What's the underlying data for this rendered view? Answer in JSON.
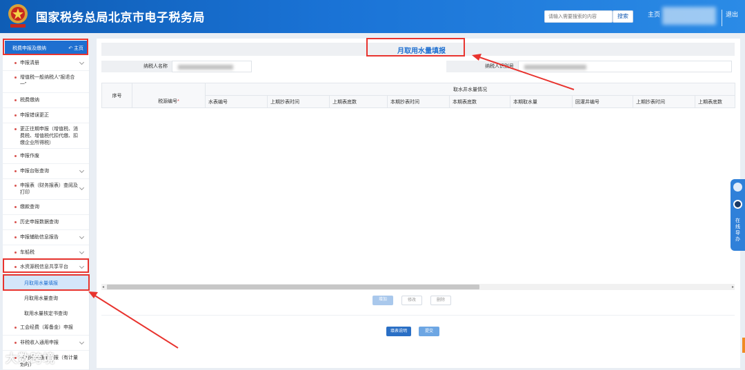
{
  "header": {
    "site_title": "国家税务总局北京市电子税务局",
    "search_placeholder": "请输入需要搜索的内容",
    "search_button": "搜索",
    "home_link": "主页",
    "logout_link": "退出"
  },
  "sidebar": {
    "header_title": "税费申报及缴纳",
    "header_home": "主页",
    "items": [
      {
        "label": "申报清册",
        "chevron": true
      },
      {
        "label": "增值税一般纳税人“报退合一”",
        "chevron": false
      },
      {
        "label": "税费缴纳",
        "chevron": false
      },
      {
        "label": "申报错误更正",
        "chevron": false
      },
      {
        "label": "更正往期申报（增值税、消费税、增值税代扣代缴、扣缴企业所得税）",
        "chevron": false
      },
      {
        "label": "申报作废",
        "chevron": false
      },
      {
        "label": "申报台账查询",
        "chevron": true
      },
      {
        "label": "申报表（财务报表）查阅及打印",
        "chevron": true
      },
      {
        "label": "缴款查询",
        "chevron": false
      },
      {
        "label": "历史申报数据查询",
        "chevron": false
      },
      {
        "label": "申报辅助信息报告",
        "chevron": true
      },
      {
        "label": "车船税",
        "chevron": true
      },
      {
        "label": "水资源税信息共享平台",
        "chevron": true
      },
      {
        "label": "工会经费（筹备金）申报",
        "chevron": false
      },
      {
        "label": "非税收入通用申报",
        "chevron": true
      },
      {
        "label": "非税收入通用申报（有计量划时）",
        "chevron": false
      }
    ],
    "sub_items": [
      {
        "label": "月取用水量填报"
      },
      {
        "label": "月取用水量查询"
      },
      {
        "label": "取用水量核定书查询"
      }
    ]
  },
  "main": {
    "page_title": "月取用水量填报",
    "taxpayer_name_label": "纳税人名称",
    "taxpayer_id_label": "纳税人识别号",
    "table": {
      "col_index": "序号",
      "col_tax_code": "税源编号",
      "required_mark": "*",
      "group_header": "取水井水量情况",
      "sub_headers": [
        "水表编号",
        "上期抄表时间",
        "上期表底数",
        "本期抄表时间",
        "本期表底数",
        "本期取水量",
        "回灌井编号",
        "上期抄表时间",
        "上期表底数"
      ]
    },
    "buttons": {
      "add": "增加",
      "edit": "修改",
      "delete": "删除",
      "instructions": "填表说明",
      "submit": "提交"
    }
  },
  "float_panel": {
    "text": "在线导办"
  },
  "watermark": "大数跨境",
  "colors": {
    "header_blue": "#1a73d6",
    "accent_blue": "#1e6fd0",
    "annotation_red": "#e8332e"
  }
}
